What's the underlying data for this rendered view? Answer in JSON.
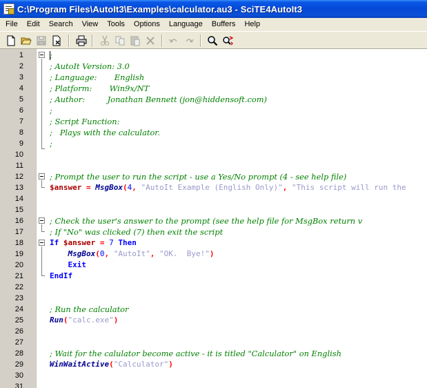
{
  "window": {
    "title": "C:\\Program Files\\AutoIt3\\Examples\\calculator.au3 - SciTE4AutoIt3",
    "icon": "scite-app-icon"
  },
  "menu": [
    "File",
    "Edit",
    "Search",
    "View",
    "Tools",
    "Options",
    "Language",
    "Buffers",
    "Help"
  ],
  "toolbar": {
    "buttons": [
      {
        "name": "new-file-icon",
        "enabled": true
      },
      {
        "name": "open-folder-icon",
        "enabled": true
      },
      {
        "name": "save-icon",
        "enabled": false
      },
      {
        "name": "close-file-icon",
        "enabled": true
      },
      {
        "name": "print-icon",
        "enabled": true
      },
      {
        "name": "cut-icon",
        "enabled": false
      },
      {
        "name": "copy-icon",
        "enabled": false
      },
      {
        "name": "paste-icon",
        "enabled": false
      },
      {
        "name": "delete-icon",
        "enabled": false
      },
      {
        "name": "undo-icon",
        "enabled": false
      },
      {
        "name": "redo-icon",
        "enabled": false
      },
      {
        "name": "find-icon",
        "enabled": true
      },
      {
        "name": "replace-icon",
        "enabled": true
      }
    ]
  },
  "editor": {
    "line_numbers": [
      "1",
      "2",
      "3",
      "4",
      "5",
      "6",
      "7",
      "8",
      "9",
      "10",
      "11",
      "12",
      "13",
      "14",
      "15",
      "16",
      "17",
      "18",
      "19",
      "20",
      "21",
      "22",
      "23",
      "24",
      "25",
      "26",
      "27",
      "28",
      "29",
      "30",
      "31"
    ],
    "lines": [
      [
        {
          "t": "cm",
          "v": ";"
        }
      ],
      [
        {
          "t": "cm",
          "v": "; AutoIt Version: 3.0"
        }
      ],
      [
        {
          "t": "cm",
          "v": "; Language:       English"
        }
      ],
      [
        {
          "t": "cm",
          "v": "; Platform:       Win9x/NT"
        }
      ],
      [
        {
          "t": "cm",
          "v": "; Author:         Jonathan Bennett (jon@hiddensoft.com)"
        }
      ],
      [
        {
          "t": "cm",
          "v": ";"
        }
      ],
      [
        {
          "t": "cm",
          "v": "; Script Function:"
        }
      ],
      [
        {
          "t": "cm",
          "v": ";   Plays with the calculator."
        }
      ],
      [
        {
          "t": "cm",
          "v": ";"
        }
      ],
      [],
      [],
      [
        {
          "t": "cm",
          "v": "; Prompt the user to run the script - use a Yes/No prompt (4 - see help file)"
        }
      ],
      [
        {
          "t": "var",
          "v": "$answer"
        },
        {
          "t": "pl",
          "v": " "
        },
        {
          "t": "op",
          "v": "="
        },
        {
          "t": "pl",
          "v": " "
        },
        {
          "t": "fn",
          "v": "MsgBox"
        },
        {
          "t": "op",
          "v": "("
        },
        {
          "t": "num",
          "v": "4"
        },
        {
          "t": "op",
          "v": ","
        },
        {
          "t": "pl",
          "v": " "
        },
        {
          "t": "str",
          "v": "\"AutoIt Example (English Only)\""
        },
        {
          "t": "op",
          "v": ","
        },
        {
          "t": "pl",
          "v": " "
        },
        {
          "t": "str",
          "v": "\"This script will run the"
        }
      ],
      [],
      [],
      [
        {
          "t": "cm",
          "v": "; Check the user's answer to the prompt (see the help file for MsgBox return v"
        }
      ],
      [
        {
          "t": "cm",
          "v": "; If \"No\" was clicked (7) then exit the script"
        }
      ],
      [
        {
          "t": "kw",
          "v": "If"
        },
        {
          "t": "pl",
          "v": " "
        },
        {
          "t": "var",
          "v": "$answer"
        },
        {
          "t": "pl",
          "v": " "
        },
        {
          "t": "op",
          "v": "="
        },
        {
          "t": "pl",
          "v": " "
        },
        {
          "t": "num",
          "v": "7"
        },
        {
          "t": "pl",
          "v": " "
        },
        {
          "t": "kw",
          "v": "Then"
        }
      ],
      [
        {
          "t": "pl",
          "v": "    "
        },
        {
          "t": "fn",
          "v": "MsgBox"
        },
        {
          "t": "op",
          "v": "("
        },
        {
          "t": "num",
          "v": "0"
        },
        {
          "t": "op",
          "v": ","
        },
        {
          "t": "pl",
          "v": " "
        },
        {
          "t": "str",
          "v": "\"AutoIt\""
        },
        {
          "t": "op",
          "v": ","
        },
        {
          "t": "pl",
          "v": " "
        },
        {
          "t": "str",
          "v": "\"OK.  Bye!\""
        },
        {
          "t": "op",
          "v": ")"
        }
      ],
      [
        {
          "t": "pl",
          "v": "    "
        },
        {
          "t": "kw",
          "v": "Exit"
        }
      ],
      [
        {
          "t": "kw",
          "v": "EndIf"
        }
      ],
      [],
      [],
      [
        {
          "t": "cm",
          "v": "; Run the calculator"
        }
      ],
      [
        {
          "t": "fn",
          "v": "Run"
        },
        {
          "t": "op",
          "v": "("
        },
        {
          "t": "str",
          "v": "\"calc.exe\""
        },
        {
          "t": "op",
          "v": ")"
        }
      ],
      [],
      [],
      [
        {
          "t": "cm",
          "v": "; Wait for the calulator become active - it is titled \"Calculator\" on English"
        }
      ],
      [
        {
          "t": "fn",
          "v": "WinWaitActive"
        },
        {
          "t": "op",
          "v": "("
        },
        {
          "t": "str",
          "v": "\"Calculator\""
        },
        {
          "t": "op",
          "v": ")"
        }
      ],
      [],
      []
    ]
  },
  "colors": {
    "comment": "#008000",
    "variable": "#aa0000",
    "function": "#000090",
    "keyword": "#0000ff",
    "string": "#9999cc",
    "operator": "#ff0000",
    "titlebar": "#0549d6"
  }
}
